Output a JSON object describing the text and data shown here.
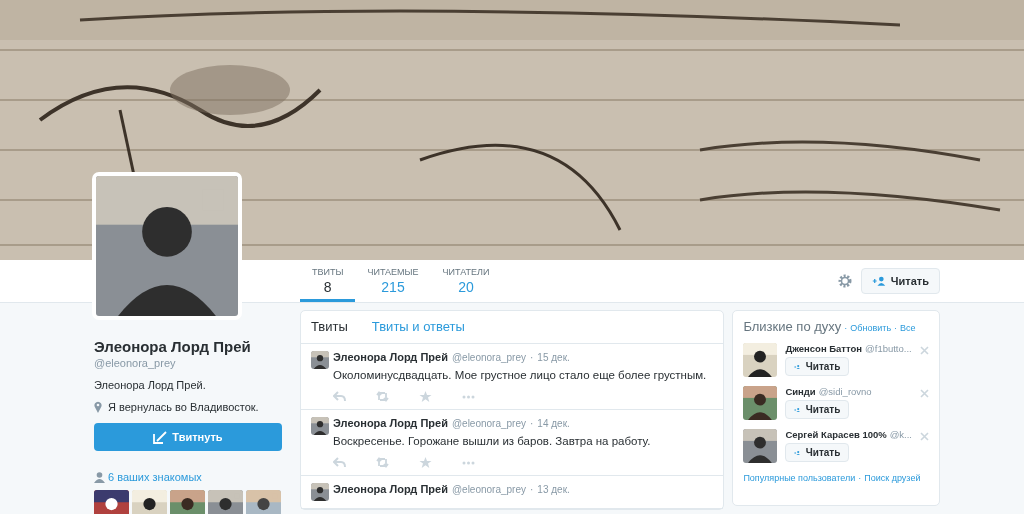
{
  "separator": "·",
  "profile": {
    "name": "Элеонора Лорд Прей",
    "handle": "@eleonora_prey",
    "bio": "Элеонора Лорд Прей.",
    "location": "Я вернулась во Владивосток.",
    "tweet_button": "Твитнуть",
    "acquaintances": "6 ваших знакомых"
  },
  "nav": {
    "stats": [
      {
        "label": "ТВИТЫ",
        "value": "8",
        "selected": true
      },
      {
        "label": "ЧИТАЕМЫЕ",
        "value": "215",
        "selected": false
      },
      {
        "label": "ЧИТАТЕЛИ",
        "value": "20",
        "selected": false
      }
    ],
    "follow_button": "Читать"
  },
  "timeline": {
    "tabs": [
      {
        "label": "Твиты",
        "selected": true
      },
      {
        "label": "Твиты и ответы",
        "selected": false
      }
    ],
    "tweets": [
      {
        "author": "Элеонора Лорд Прей",
        "handle": "@eleonora_prey",
        "date": "15 дек.",
        "text": "Околоминусдвадцать. Мое грустное лицо стало еще более грустным."
      },
      {
        "author": "Элеонора Лорд Прей",
        "handle": "@eleonora_prey",
        "date": "14 дек.",
        "text": "Воскресенье. Горожане вышли из баров. Завтра на работу."
      },
      {
        "author": "Элеонора Лорд Прей",
        "handle": "@eleonora_prey",
        "date": "13 дек."
      }
    ]
  },
  "suggestions": {
    "title": "Близкие по духу",
    "links": [
      "Обновить",
      "Все"
    ],
    "users": [
      {
        "name": "Дженсон Баттон",
        "handle": "@f1butto...",
        "button": "Читать"
      },
      {
        "name": "Синди",
        "handle": "@sidi_rovno",
        "button": "Читать"
      },
      {
        "name": "Сергей Карасев 100%",
        "handle": "@k...",
        "button": "Читать"
      }
    ],
    "footer_links": [
      "Популярные пользователи",
      "Поиск друзей"
    ]
  }
}
